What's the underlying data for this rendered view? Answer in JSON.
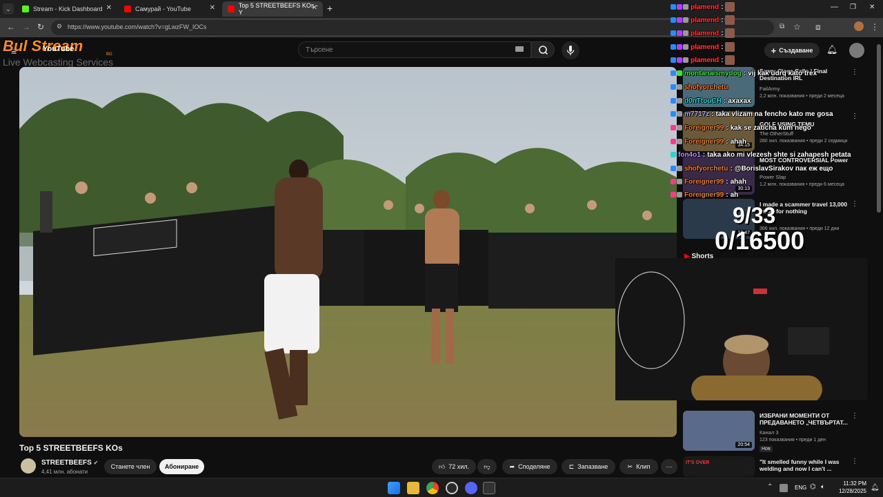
{
  "browser": {
    "tabs": [
      {
        "label": "Stream - Kick Dashboard",
        "color": "#53fc18"
      },
      {
        "label": "Самурай - YouTube",
        "color": "#ff0000"
      },
      {
        "label": "Top 5 STREETBEEFS KOs - Y",
        "color": "#ff0000"
      }
    ],
    "url": "https://www.youtube.com/watch?v=gLwzFW_IOCs"
  },
  "overlay_logo": {
    "main": "Bul Stream",
    "sub": "Live Webcasting Services",
    "yt_wordmark": "YouTube",
    "badge": "BG"
  },
  "youtube": {
    "search_placeholder": "Търсене",
    "create_label": "Създаване",
    "video_title": "Top 5 STREETBEEFS KOs",
    "channel_name": "STREETBEEFS",
    "channel_subs": "4,41 млн. абонати",
    "join_label": "Станете член",
    "subscribe_label": "Абониране",
    "likes_label": "72 хил.",
    "share_label": "Споделяне",
    "save_label": "Запазване",
    "clip_label": "Клип",
    "shorts_label": "Shorts"
  },
  "recommendations": [
    {
      "title": "Scary Close Calls | Final Destination IRL",
      "channel": "FailArmy",
      "meta": "2,2 млн. показвания • преди 2 месеца",
      "duration": ""
    },
    {
      "title": "GOLF USING TEMU",
      "channel": "The OtherStuff",
      "meta": "280 хил. показвания • преди 2 седмици",
      "duration": "34:15"
    },
    {
      "title": "MOST CONTROVERSIAL Power",
      "channel": "Power Slap",
      "meta": "1,2 млн. показвания • преди 6 месеца",
      "duration": "30:13"
    },
    {
      "title": "I made a scammer travel 13,000 miles for nothing",
      "channel": "",
      "meta": "366 хил. показвания • преди 12 дни",
      "duration": "18:47"
    },
    {
      "title": "ИЗБРАНИ МОМЕНТИ ОТ ПРЕДАВАНЕТО „ЧЕТВЪРТАТ...",
      "channel": "Канал 3",
      "meta": "123 показвания • преди 1 ден",
      "badge": "Нов",
      "duration": "20:54"
    },
    {
      "title": "\"It smelled funny while I was welding and now I can't ...",
      "channel": "",
      "meta": "",
      "thumb_text": "IT'S OVER",
      "duration": ""
    }
  ],
  "chat": [
    {
      "user": "plamend",
      "color": "#ff3a3a",
      "msg": ""
    },
    {
      "user": "plamend",
      "color": "#ff3a3a",
      "msg": ""
    },
    {
      "user": "plamend",
      "color": "#ff3a3a",
      "msg": ""
    },
    {
      "user": "plamend",
      "color": "#ff3a3a",
      "msg": ""
    },
    {
      "user": "plamend",
      "color": "#ff3a3a",
      "msg": ""
    },
    {
      "user": "montanaismydog",
      "color": "#39e639",
      "msg": "vij kak udrq kato trex"
    },
    {
      "user": "shofyorchetu",
      "color": "#ff7a1a",
      "msg": ""
    },
    {
      "user": "d0nTtouCH",
      "color": "#2bd4d4",
      "msg": "axaxax"
    },
    {
      "user": "m7717z",
      "color": "#b0b0ff",
      "msg": "taka vlizam na fencho kato me gosa"
    },
    {
      "user": "Foreigner99",
      "color": "#ff7a1a",
      "msg": "kak se zaticha kum nego"
    },
    {
      "user": "Foreigner99",
      "color": "#ff7a1a",
      "msg": "ahah"
    },
    {
      "user": "fon4o1",
      "color": "#c08cff",
      "msg": "taka ako mi vlezesh shte si zahapesh petata"
    },
    {
      "user": "shofyorchetu",
      "color": "#ff7a1a",
      "msg": "@BorislavSirakov пак еж ещо"
    },
    {
      "user": "Foreigner99",
      "color": "#ff7a1a",
      "msg": "ahah"
    },
    {
      "user": "Foreigner99",
      "color": "#ff7a1a",
      "msg": "ah"
    }
  ],
  "counter": {
    "a": "9/33",
    "b": "0/16500"
  },
  "taskbar": {
    "lang": "ENG",
    "time": "11:32 PM",
    "date": "12/28/2025"
  }
}
